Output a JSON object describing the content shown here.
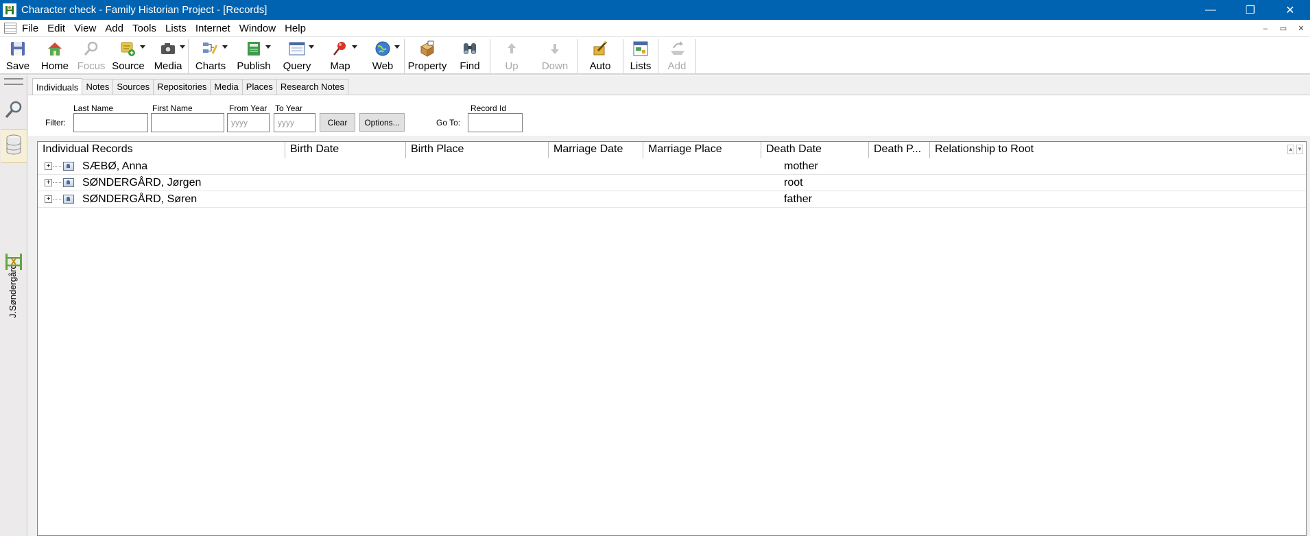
{
  "window": {
    "title": "Character check - Family Historian Project - [Records]",
    "minimize": "—",
    "restore": "❐",
    "close": "✕"
  },
  "menu": [
    "File",
    "Edit",
    "View",
    "Add",
    "Tools",
    "Lists",
    "Internet",
    "Window",
    "Help"
  ],
  "mdi": {
    "minimize": "–",
    "restore": "▭",
    "close": "✕"
  },
  "toolbar": {
    "save": "Save",
    "home": "Home",
    "focus": "Focus",
    "source": "Source",
    "media": "Media",
    "charts": "Charts",
    "publish": "Publish",
    "query": "Query",
    "map": "Map",
    "web": "Web",
    "property": "Property",
    "find": "Find",
    "up": "Up",
    "down": "Down",
    "auto": "Auto",
    "lists": "Lists",
    "add": "Add"
  },
  "sidebar": {
    "focus_label": "J.Søndergård"
  },
  "tabs": [
    "Individuals",
    "Notes",
    "Sources",
    "Repositories",
    "Media",
    "Places",
    "Research Notes"
  ],
  "filter": {
    "filter_label": "Filter:",
    "last_name_label": "Last Name",
    "first_name_label": "First Name",
    "from_year_label": "From Year",
    "to_year_label": "To Year",
    "from_year_placeholder": "yyyy",
    "to_year_placeholder": "yyyy",
    "clear": "Clear",
    "options": "Options...",
    "goto_label": "Go To:",
    "record_id_label": "Record Id"
  },
  "grid": {
    "columns": [
      "Individual Records",
      "Birth Date",
      "Birth Place",
      "Marriage Date",
      "Marriage Place",
      "Death Date",
      "Death P...",
      "Relationship to Root"
    ],
    "rows": [
      {
        "name": "SÆBØ, Anna",
        "relationship": "mother"
      },
      {
        "name": "SØNDERGÅRD, Jørgen",
        "relationship": "root"
      },
      {
        "name": "SØNDERGÅRD, Søren",
        "relationship": "father"
      }
    ]
  },
  "colors": {
    "titlebar": "#0063b1",
    "panel": "#f0f0f0",
    "sidebar_active": "#f7f0d6"
  }
}
